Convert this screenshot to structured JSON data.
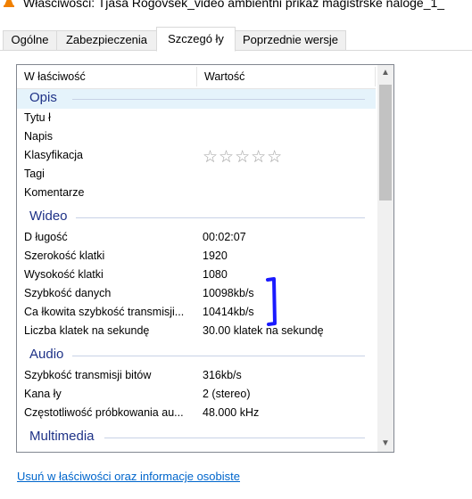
{
  "window": {
    "title": "Właściwości: Tjaša Rogovšek_video ambientni prikaz magistrske naloge_1_"
  },
  "tabs": [
    {
      "label": "Ogólne"
    },
    {
      "label": "Zabezpieczenia"
    },
    {
      "label": "Szczegó ły"
    },
    {
      "label": "Poprzednie wersje"
    }
  ],
  "active_tab": "Szczegó ły",
  "table": {
    "col_property": "W łaściwość",
    "col_value": "Wartość"
  },
  "groups": {
    "opis": "Opis",
    "wideo": "Wideo",
    "audio": "Audio",
    "multimedia": "Multimedia"
  },
  "opis_rows": [
    {
      "key": "Tytu ł",
      "value": ""
    },
    {
      "key": "Napis",
      "value": ""
    },
    {
      "key": "Klasyfikacja",
      "value": ""
    },
    {
      "key": "Tagi",
      "value": ""
    },
    {
      "key": "Komentarze",
      "value": ""
    }
  ],
  "rating": {
    "stars_filled": 0,
    "stars_total": 5,
    "glyphs": "☆☆☆☆☆"
  },
  "wideo_rows": [
    {
      "key": "D ługość",
      "value": "00:02:07"
    },
    {
      "key": "Szerokość klatki",
      "value": "1920"
    },
    {
      "key": "Wysokość klatki",
      "value": "1080"
    },
    {
      "key": "Szybkość danych",
      "value": "10098kb/s"
    },
    {
      "key": "Ca łkowita szybkość transmisji...",
      "value": "10414kb/s"
    },
    {
      "key": "Liczba klatek na sekundę",
      "value": "30.00 klatek na sekundę"
    }
  ],
  "audio_rows": [
    {
      "key": "Szybkość transmisji bitów",
      "value": "316kb/s"
    },
    {
      "key": "Kana ły",
      "value": "2 (stereo)"
    },
    {
      "key": "Częstotliwość próbkowania au...",
      "value": "48.000 kHz"
    }
  ],
  "footer": {
    "remove_link": "Usuń w łaściwości oraz informacje osobiste"
  },
  "colors": {
    "group_text": "#1e3287",
    "link": "#0066cc",
    "selection": "#e5f3fb",
    "annotation": "#1a1aff"
  },
  "icons": {
    "title": "vlc-cone-icon",
    "scroll_up": "chevron-up-icon",
    "scroll_down": "chevron-down-icon"
  }
}
